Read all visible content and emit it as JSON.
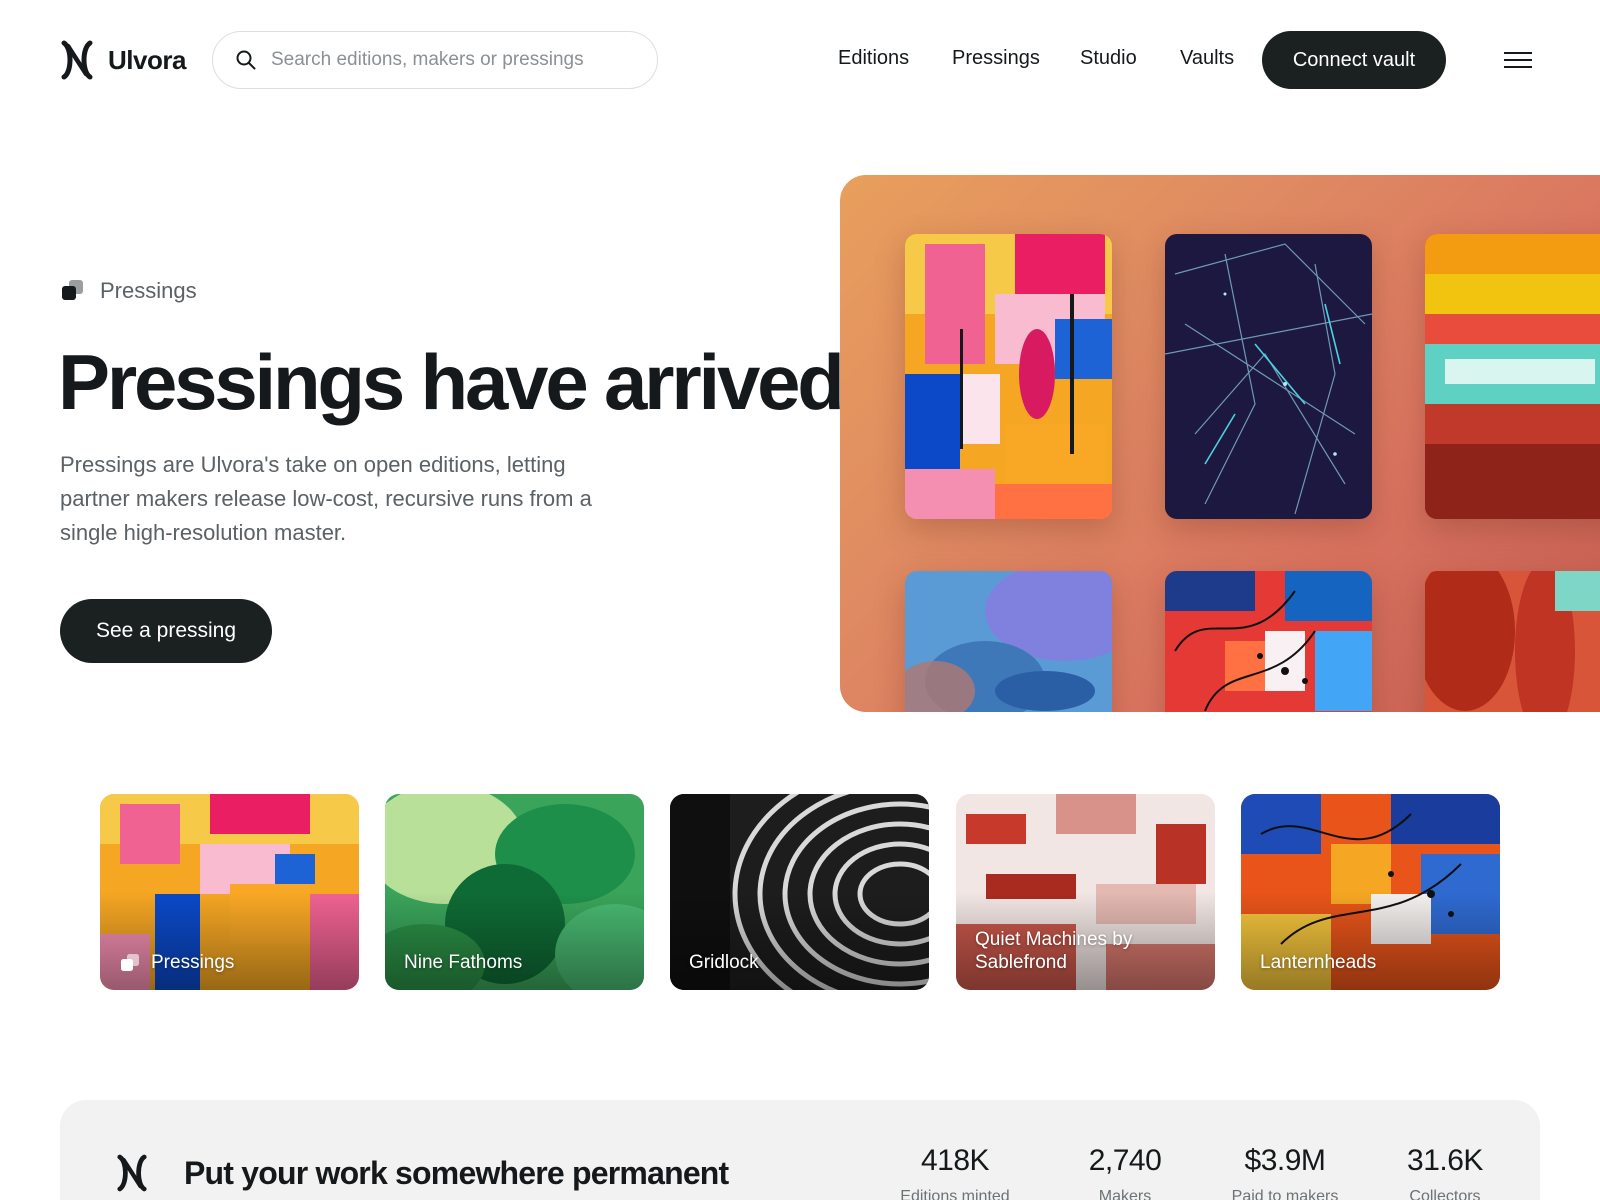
{
  "brand": {
    "name": "Ulvora",
    "logo_icon": "ulvora-logo-icon"
  },
  "search": {
    "placeholder": "Search editions, makers or pressings",
    "value": "",
    "icon": "search-icon"
  },
  "nav": {
    "items": [
      {
        "label": "Editions"
      },
      {
        "label": "Pressings"
      },
      {
        "label": "Studio"
      },
      {
        "label": "Vaults"
      }
    ],
    "connect_label": "Connect vault",
    "menu_icon": "hamburger-menu-icon"
  },
  "hero": {
    "eyebrow": "Pressings",
    "eyebrow_icon": "pressings-stack-icon",
    "title": "Pressings have arrived",
    "description": "Pressings are Ulvora's take on open editions, letting partner makers release low-cost, recursive runs from a single high-resolution master.",
    "cta_label": "See a pressing",
    "panel_gradient": [
      "#e89f5c",
      "#df8a62",
      "#d97460",
      "#c65e52"
    ]
  },
  "collections": [
    {
      "label": "Pressings",
      "has_icon": true
    },
    {
      "label": "Nine Fathoms"
    },
    {
      "label": "Gridlock"
    },
    {
      "label": "Quiet Machines by Sablefrond"
    },
    {
      "label": "Lanternheads"
    }
  ],
  "band": {
    "title": "Put your work somewhere permanent",
    "stats": [
      {
        "value": "418K",
        "label": "Editions minted"
      },
      {
        "value": "2,740",
        "label": "Makers"
      },
      {
        "value": "$3.9M",
        "label": "Paid to makers"
      },
      {
        "value": "31.6K",
        "label": "Collectors"
      }
    ]
  },
  "colors": {
    "primary_dark": "#1b2121",
    "text": "#16191b",
    "muted": "#5b6165",
    "band_bg": "#f1f2f1"
  }
}
